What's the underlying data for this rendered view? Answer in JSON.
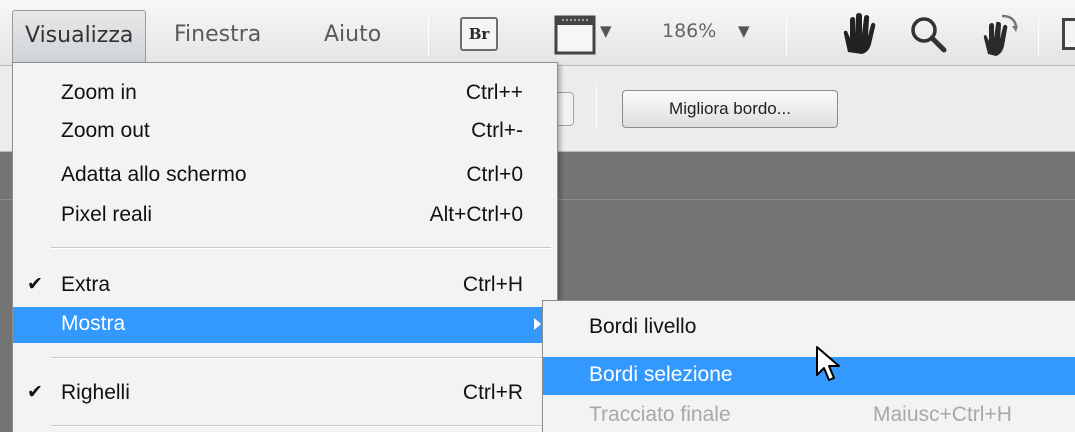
{
  "menubar": {
    "menus": [
      {
        "label": "Visualizza",
        "open": true
      },
      {
        "label": "Finestra"
      },
      {
        "label": "Aiuto"
      }
    ],
    "br_label": "Br",
    "zoom": "186%"
  },
  "options": {
    "refine_edge_label": "Migliora bordo..."
  },
  "view_menu": {
    "items": [
      {
        "label": "Zoom in",
        "shortcut": "Ctrl++"
      },
      {
        "label": "Zoom out",
        "shortcut": "Ctrl+-"
      },
      {
        "label": "Adatta allo schermo",
        "shortcut": "Ctrl+0"
      },
      {
        "label": "Pixel reali",
        "shortcut": "Alt+Ctrl+0"
      },
      {
        "label": "Extra",
        "shortcut": "Ctrl+H",
        "checked": true,
        "check": "✔"
      },
      {
        "label": "Mostra",
        "highlighted": true,
        "has_submenu": true
      },
      {
        "label": "Righelli",
        "shortcut": "Ctrl+R",
        "checked": true,
        "check": "✔"
      }
    ]
  },
  "show_submenu": {
    "items": [
      {
        "label": "Bordi livello"
      },
      {
        "label": "Bordi selezione",
        "highlighted": true
      },
      {
        "label": "Tracciato finale",
        "shortcut": "Maiusc+Ctrl+H",
        "disabled": true
      }
    ]
  },
  "colors": {
    "highlight": "#3399ff",
    "canvas": "#747474",
    "menu_bg": "#f3f3f3"
  }
}
